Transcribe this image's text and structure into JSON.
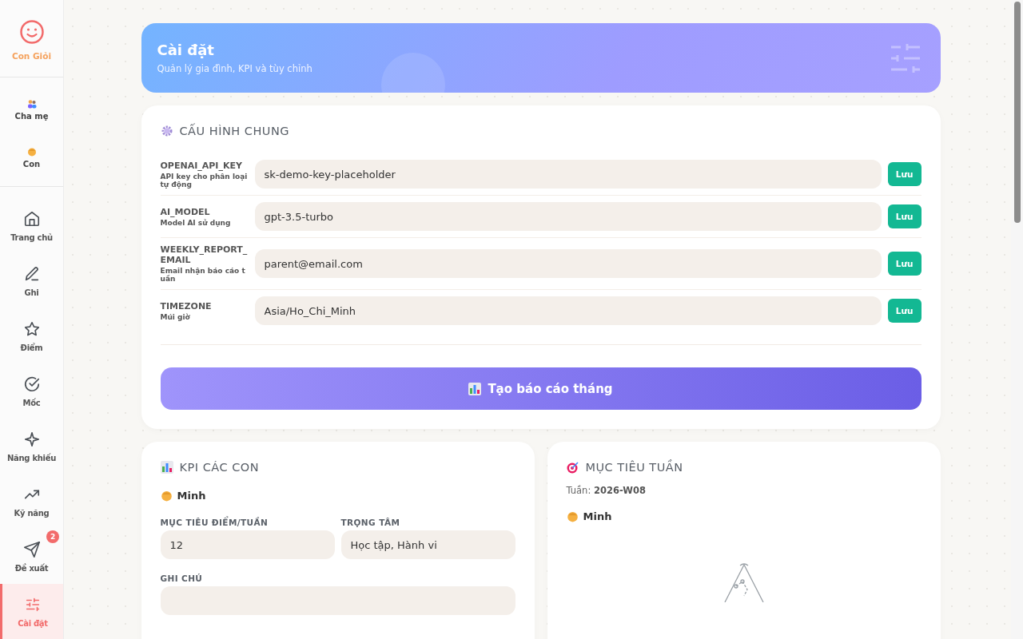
{
  "brand": {
    "name": "Con Giỏi"
  },
  "profiles": [
    {
      "label": "Cha mẹ",
      "kind": "parents"
    },
    {
      "label": "Con",
      "kind": "child"
    }
  ],
  "nav": [
    {
      "label": "Trang chủ",
      "kind": "home",
      "selected": false
    },
    {
      "label": "Ghi",
      "kind": "write",
      "selected": false
    },
    {
      "label": "Điểm",
      "kind": "points",
      "selected": false
    },
    {
      "label": "Mốc",
      "kind": "milestones",
      "selected": false
    },
    {
      "label": "Năng khiếu",
      "kind": "talents",
      "selected": false
    },
    {
      "label": "Kỹ năng",
      "kind": "skills",
      "selected": false
    },
    {
      "label": "Đề xuất",
      "kind": "suggestions",
      "selected": false,
      "badge": "2"
    },
    {
      "label": "Cài đặt",
      "kind": "settings",
      "selected": true
    }
  ],
  "header": {
    "title": "Cài đặt",
    "subtitle": "Quản lý gia đình, KPI và tùy chỉnh"
  },
  "general": {
    "title": "CẤU HÌNH CHUNG",
    "settings": [
      {
        "key": "OPENAI_API_KEY",
        "description": "API key cho phân loại tự động",
        "value": "sk-demo-key-placeholder",
        "button": "Lưu"
      },
      {
        "key": "AI_MODEL",
        "description": "Model AI sử dụng",
        "value": "gpt-3.5-turbo",
        "button": "Lưu"
      },
      {
        "key": "WEEKLY_REPORT_EMAIL",
        "description": "Email nhận báo cáo tuần",
        "value": "parent@email.com",
        "button": "Lưu"
      },
      {
        "key": "TIMEZONE",
        "description": "Múi giờ",
        "value": "Asia/Ho_Chi_Minh",
        "button": "Lưu"
      }
    ],
    "report_button": "Tạo báo cáo tháng"
  },
  "kpi": {
    "title": "KPI CÁC CON",
    "child": "Minh",
    "fields": [
      {
        "label": "MỤC TIÊU ĐIỂM/TUẦN",
        "value": "12"
      },
      {
        "label": "TRỌNG TÂM",
        "value": "Học tập, Hành vi"
      }
    ],
    "note_label": "GHI CHÚ"
  },
  "weekly": {
    "title": "MỤC TIÊU TUẦN",
    "week_label": "Tuần:",
    "week": "2026-W08",
    "child": "Minh"
  }
}
